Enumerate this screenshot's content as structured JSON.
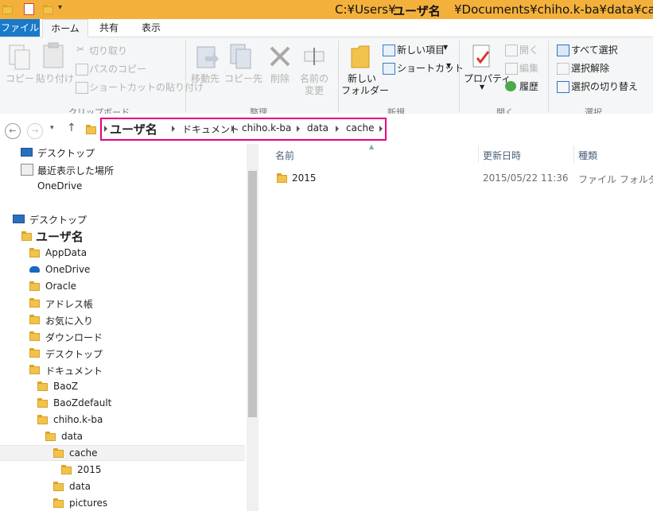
{
  "window": {
    "title_path_start": "C:¥Users¥",
    "title_user": "ユーザ名",
    "title_path_end": "¥Documents¥chiho.k-ba¥data¥cache"
  },
  "ribbon_tabs": [
    "ファイル",
    "ホーム",
    "共有",
    "表示"
  ],
  "ribbon": {
    "clipboard": {
      "copy": "コピー",
      "paste": "貼り付け",
      "cut": "切り取り",
      "copy_path": "パスのコピー",
      "paste_shortcut": "ショートカットの貼り付け",
      "group": "クリップボード"
    },
    "organize": {
      "move_to": "移動先",
      "copy_to": "コピー先",
      "delete": "削除",
      "rename_1": "名前の",
      "rename_2": "変更",
      "group": "整理"
    },
    "new": {
      "new_folder_1": "新しい",
      "new_folder_2": "フォルダー",
      "new_item": "新しい項目",
      "shortcut": "ショートカット",
      "group": "新規"
    },
    "open": {
      "properties": "プロパティ",
      "open": "開く",
      "edit": "編集",
      "history": "履歴",
      "group": "開く"
    },
    "select": {
      "select_all": "すべて選択",
      "select_none": "選択解除",
      "invert": "選択の切り替え",
      "group": "選択"
    }
  },
  "address": {
    "crumbs": [
      "ユーザ名",
      "ドキュメント",
      "chiho.k-ba",
      "data",
      "cache"
    ]
  },
  "nav": {
    "favorites": [
      "デスクトップ",
      "最近表示した場所",
      "OneDrive"
    ],
    "desktop": "デスクトップ",
    "user": "ユーザ名",
    "user_children": [
      "AppData",
      "OneDrive",
      "Oracle",
      "アドレス帳",
      "お気に入り",
      "ダウンロード",
      "デスクトップ",
      "ドキュメント"
    ],
    "doc_children": [
      "BaoZ",
      "BaoZdefault",
      "chiho.k-ba"
    ],
    "chiho_children": [
      "data"
    ],
    "data_children": [
      "cache"
    ],
    "cache_children": [
      "2015"
    ],
    "more": [
      "data",
      "pictures"
    ]
  },
  "content": {
    "columns": [
      "名前",
      "更新日時",
      "種類"
    ],
    "rows": [
      {
        "name": "2015",
        "modified": "2015/05/22 11:36",
        "type": "ファイル フォルダー"
      }
    ]
  },
  "colors": {
    "titlebar": "#f3b13c",
    "file_tab": "#1979ca",
    "highlight_border": "#e4007f"
  }
}
